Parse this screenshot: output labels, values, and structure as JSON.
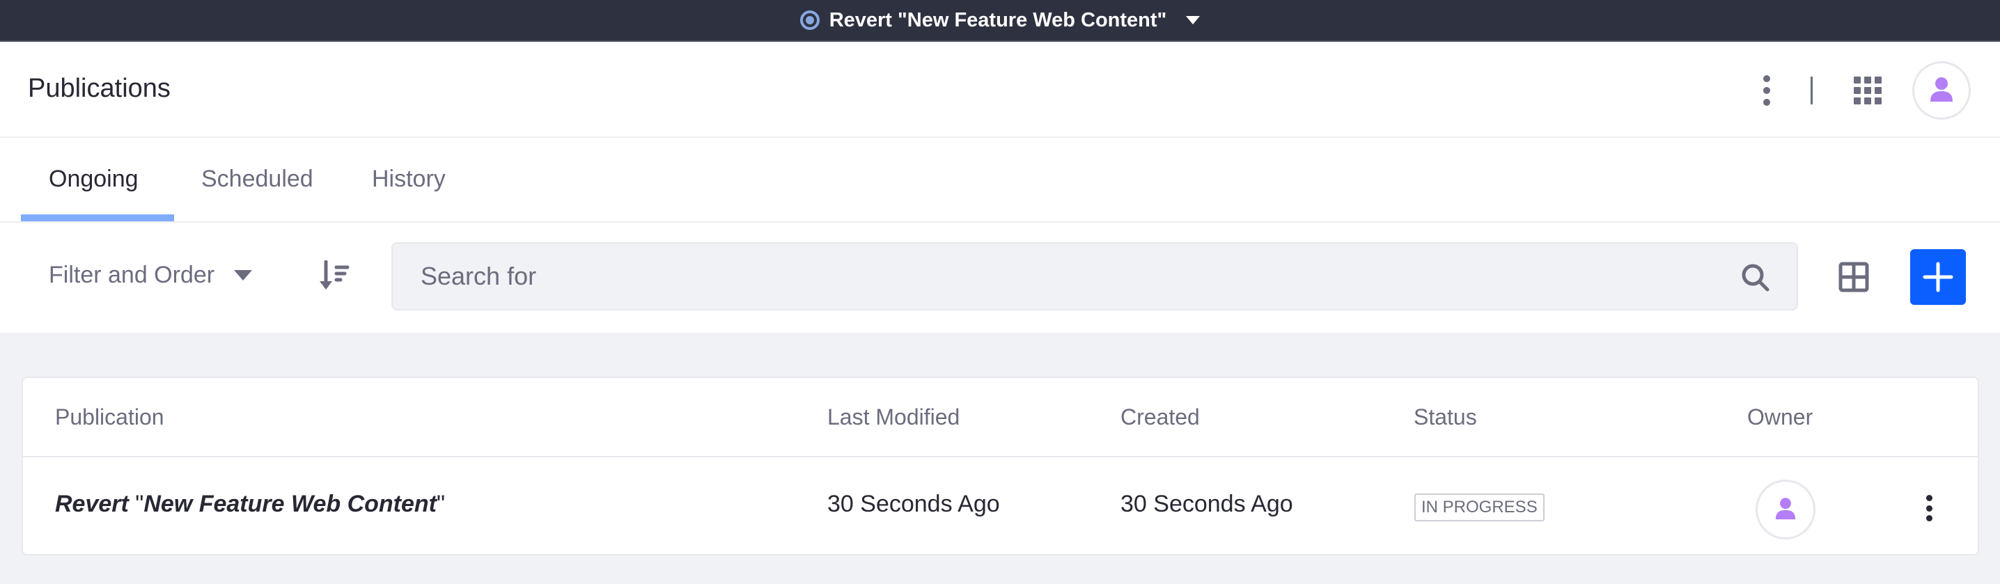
{
  "topbar": {
    "publication_selector": "Revert \"New Feature Web Content\"",
    "status_icon": "radio-selected-icon",
    "dropdown_icon": "caret-down-icon"
  },
  "header": {
    "title": "Publications",
    "icons": [
      "ellipsis-v-icon",
      "apps-grid-icon",
      "user-avatar-icon"
    ]
  },
  "tabs": [
    {
      "label": "Ongoing",
      "active": true
    },
    {
      "label": "Scheduled",
      "active": false
    },
    {
      "label": "History",
      "active": false
    }
  ],
  "toolbar": {
    "filter_label": "Filter and Order",
    "sort_icon": "order-arrow-down-icon",
    "search_placeholder": "Search for",
    "search_value": "",
    "view_icon": "cards-view-icon",
    "add_icon": "plus-icon"
  },
  "table": {
    "columns": [
      "Publication",
      "Last Modified",
      "Created",
      "Status",
      "Owner"
    ],
    "rows": [
      {
        "publication_prefix": "Revert ",
        "publication_quoted": "New Feature Web Content",
        "last_modified": "30 Seconds Ago",
        "created": "30 Seconds Ago",
        "status": "In Progress",
        "owner_icon": "user-avatar-icon"
      }
    ]
  },
  "colors": {
    "topbar_bg": "#2e3140",
    "primary": "#0b5fff",
    "tab_indicator": "#80acff",
    "avatar_icon": "#b37ef7",
    "text_secondary": "#6b6c7e",
    "text_primary": "#272833"
  }
}
